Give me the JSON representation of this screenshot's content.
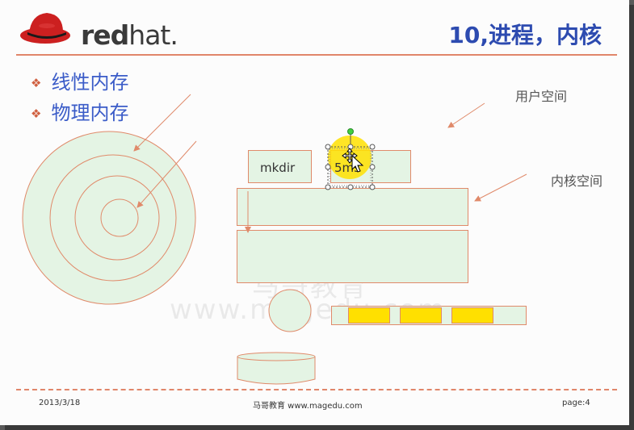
{
  "slide": {
    "logo": {
      "text_bold": "red",
      "text_light": "hat."
    },
    "title": "10,进程，内核",
    "bullets": [
      "线性内存",
      "物理内存"
    ],
    "labels": {
      "user_space": "用户空间",
      "kernel_space": "内核空间"
    },
    "boxes": {
      "mkdir": "mkdir",
      "five_ms": "5ms"
    },
    "watermark": {
      "line1": "马哥教育",
      "line2": "www.magedu.com"
    },
    "footer": {
      "date": "2013/3/18",
      "center": "马哥教育 www.magedu.com",
      "page_label": "page:",
      "page_number": "4"
    }
  },
  "colors": {
    "accent_line": "#e0866a",
    "title_blue": "#2d4bb0",
    "box_fill": "#e4f4e4",
    "highlight_yellow": "#ffe000"
  }
}
